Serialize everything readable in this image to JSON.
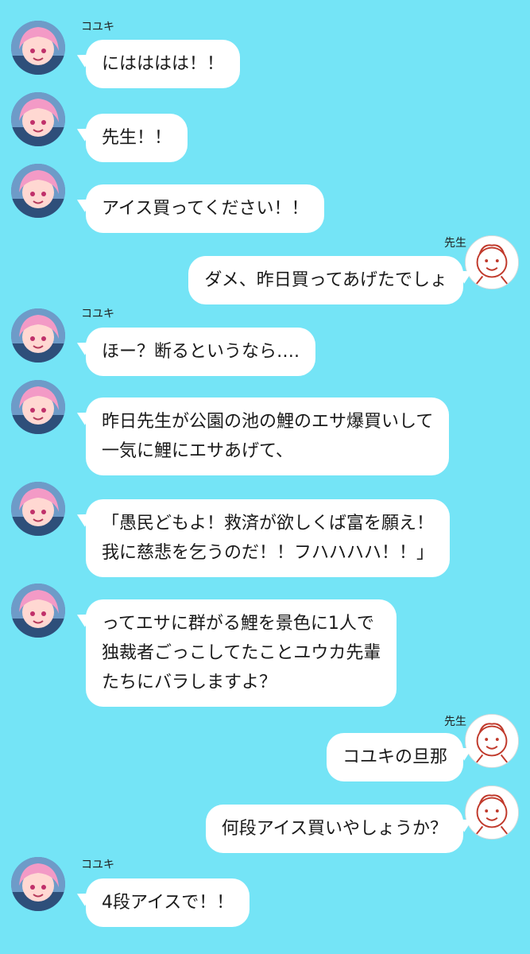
{
  "messages": [
    {
      "sender": "koyuki",
      "name": "コユキ",
      "lines": [
        "にはははは！！"
      ]
    },
    {
      "sender": "koyuki",
      "name": "",
      "lines": [
        "先生！！"
      ]
    },
    {
      "sender": "koyuki",
      "name": "",
      "lines": [
        "アイス買ってください！！"
      ]
    },
    {
      "sender": "sensei",
      "name": "先生",
      "lines": [
        "ダメ、昨日買ってあげたでしょ"
      ]
    },
    {
      "sender": "koyuki",
      "name": "コユキ",
      "lines": [
        "ほー？断るというなら…."
      ]
    },
    {
      "sender": "koyuki",
      "name": "",
      "lines": [
        "昨日先生が公園の池の鯉のエサ爆買いして",
        "一気に鯉にエサあげて、"
      ]
    },
    {
      "sender": "koyuki",
      "name": "",
      "lines": [
        "「愚民どもよ！救済が欲しくば富を願え！",
        "我に慈悲を乞うのだ！！フハハハハ！！」"
      ]
    },
    {
      "sender": "koyuki",
      "name": "",
      "lines": [
        "ってエサに群がる鯉を景色に1人で",
        "独裁者ごっこしてたことユウカ先輩",
        "たちにバラしますよ？"
      ]
    },
    {
      "sender": "sensei",
      "name": "先生",
      "lines": [
        "コユキの旦那"
      ]
    },
    {
      "sender": "sensei",
      "name": "",
      "lines": [
        "何段アイス買いやしょうか？"
      ]
    },
    {
      "sender": "koyuki",
      "name": "コユキ",
      "lines": [
        "4段アイスで！！"
      ]
    }
  ],
  "colors": {
    "background": "#74e4f6",
    "bubble": "#ffffff",
    "text": "#1a1a1a"
  },
  "icons": {
    "koyuki": "koyuki-avatar-icon",
    "sensei": "sensei-avatar-icon"
  }
}
